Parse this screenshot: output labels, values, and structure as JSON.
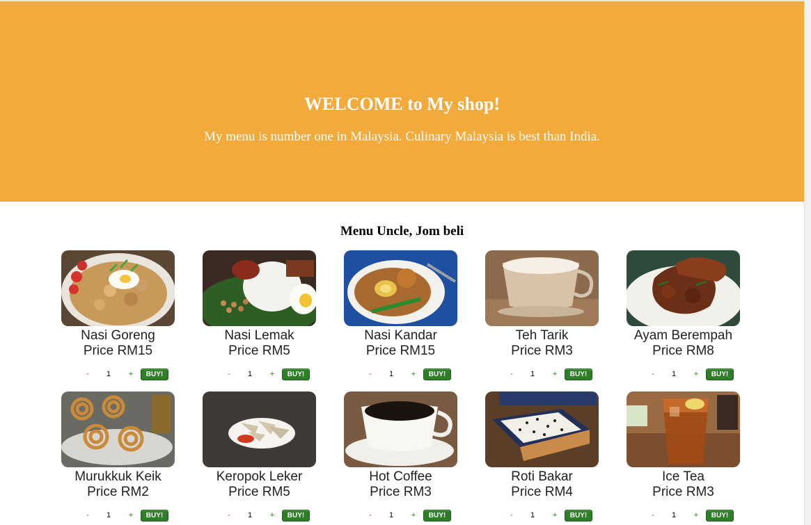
{
  "hero": {
    "title": "WELCOME to My shop!",
    "subtitle": "My menu is number one in Malaysia. Culinary Malaysia is best than India."
  },
  "menu": {
    "title": "Menu Uncle, Jom beli",
    "buy_label": "BUY!",
    "minus_label": "-",
    "plus_label": "+",
    "items": [
      {
        "name": "Nasi Goreng",
        "price": "Price RM15",
        "qty": "1",
        "image": "nasi-goreng-photo"
      },
      {
        "name": "Nasi Lemak",
        "price": "Price RM5",
        "qty": "1",
        "image": "nasi-lemak-photo"
      },
      {
        "name": "Nasi Kandar",
        "price": "Price RM15",
        "qty": "1",
        "image": "nasi-kandar-photo"
      },
      {
        "name": "Teh Tarik",
        "price": "Price RM3",
        "qty": "1",
        "image": "teh-tarik-photo"
      },
      {
        "name": "Ayam Berempah",
        "price": "Price RM8",
        "qty": "1",
        "image": "ayam-berempah-photo"
      },
      {
        "name": "Murukkuk Keik",
        "price": "Price RM2",
        "qty": "1",
        "image": "murukku-photo"
      },
      {
        "name": "Keropok Leker",
        "price": "Price RM5",
        "qty": "1",
        "image": "keropok-photo"
      },
      {
        "name": "Hot Coffee",
        "price": "Price RM3",
        "qty": "1",
        "image": "hot-coffee-photo"
      },
      {
        "name": "Roti Bakar",
        "price": "Price RM4",
        "qty": "1",
        "image": "roti-bakar-photo"
      },
      {
        "name": "Ice Tea",
        "price": "Price RM3",
        "qty": "1",
        "image": "ice-tea-photo"
      }
    ]
  },
  "colors": {
    "hero_bg": "#f2aa3b",
    "buy_button": "#2f7d28"
  }
}
